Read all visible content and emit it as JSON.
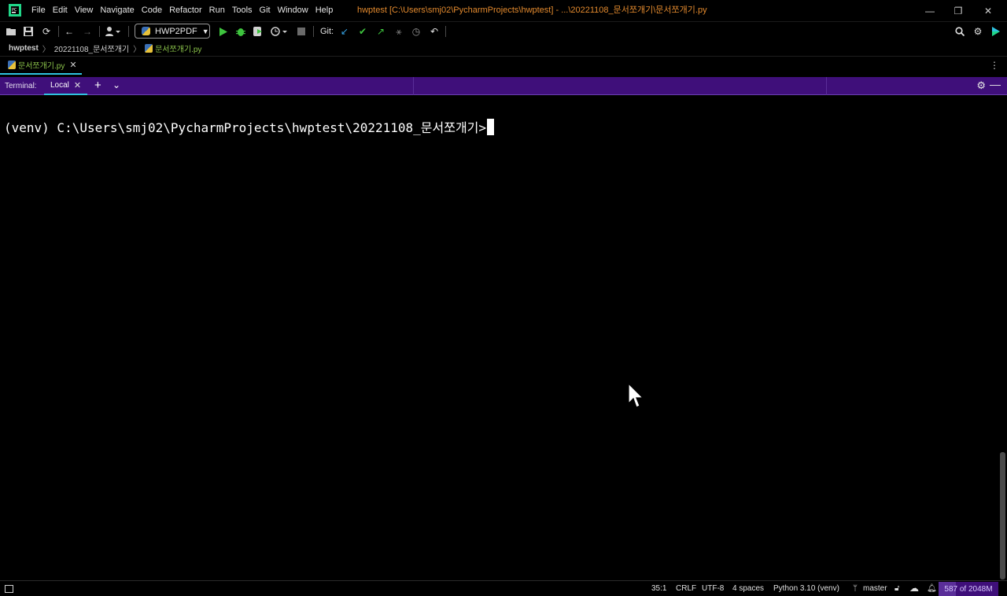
{
  "app": {
    "icon": "pycharm-logo-icon",
    "window_title": "hwptest [C:\\Users\\smj02\\PycharmProjects\\hwptest] - ...\\20221108_문서쪼개기\\문서쪼개기.py"
  },
  "menu": [
    "File",
    "Edit",
    "View",
    "Navigate",
    "Code",
    "Refactor",
    "Run",
    "Tools",
    "Git",
    "Window",
    "Help"
  ],
  "window_controls": {
    "minimize": "—",
    "restore": "❐",
    "close": "✕"
  },
  "toolbar": {
    "run_config": "HWP2PDF",
    "git_label": "Git:"
  },
  "breadcrumb": {
    "project": "hwptest",
    "folder": "20221108_문서쪼개기",
    "file": "문서쪼개기.py"
  },
  "editor_tab": {
    "label": "문서쪼개기.py"
  },
  "terminal": {
    "label": "Terminal:",
    "tab": "Local",
    "prompt": "(venv) C:\\Users\\smj02\\PycharmProjects\\hwptest\\20221108_문서쪼개기>"
  },
  "statusbar": {
    "position": "35:1",
    "line_ending": "CRLF",
    "encoding": "UTF-8",
    "indent": "4 spaces",
    "interpreter": "Python 3.10 (venv)",
    "branch": "master",
    "memory": "587 of 2048M",
    "memory_used_fraction": 0.287
  },
  "colors": {
    "accent_purple": "#3f0f7a",
    "tab_underline": "#2fc3e0",
    "title_orange": "#e38a2e",
    "file_green": "#8bc34a"
  }
}
